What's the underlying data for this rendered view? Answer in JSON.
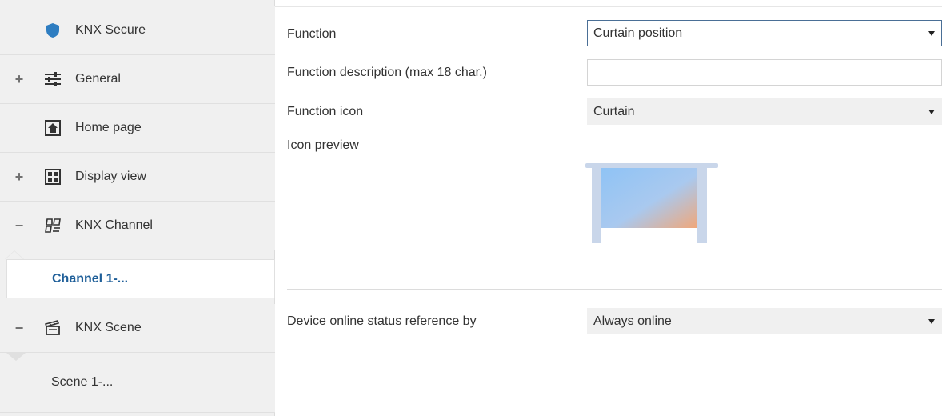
{
  "sidebar": {
    "items": [
      {
        "label": "KNX Secure",
        "icon": "shield-icon",
        "expander": ""
      },
      {
        "label": "General",
        "icon": "sliders-icon",
        "expander": "+"
      },
      {
        "label": "Home page",
        "icon": "home-icon",
        "expander": ""
      },
      {
        "label": "Display view",
        "icon": "grid-icon",
        "expander": "+"
      },
      {
        "label": "KNX Channel",
        "icon": "knx-channel-icon",
        "expander": "−"
      },
      {
        "label": "KNX Scene",
        "icon": "clapperboard-icon",
        "expander": "−"
      }
    ],
    "channel_child": "Channel 1-...",
    "scene_child": "Scene 1-..."
  },
  "form": {
    "function_label": "Function",
    "function_value": "Curtain position",
    "description_label": "Function description (max 18 char.)",
    "description_value": "",
    "icon_label": "Function icon",
    "icon_value": "Curtain",
    "preview_label": "Icon preview",
    "online_label": "Device online status reference by",
    "online_value": "Always online"
  },
  "colors": {
    "accent": "#1f5f99",
    "shield": "#2e7dc1",
    "sidebar_bg": "#f0f0f0"
  }
}
